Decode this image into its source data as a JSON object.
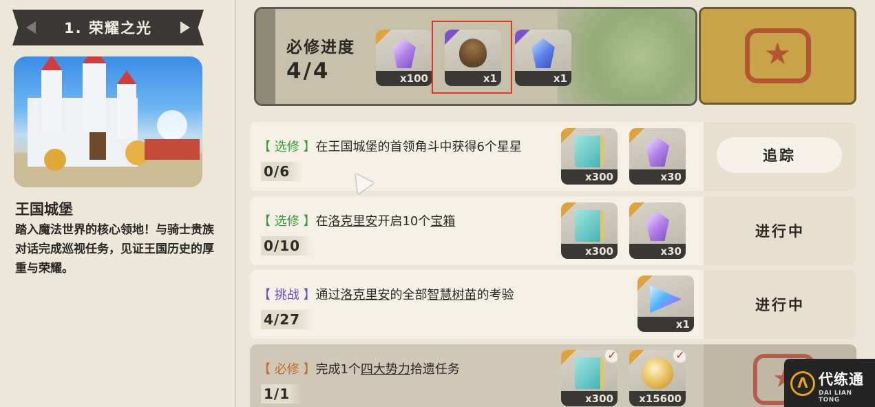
{
  "left": {
    "title": "1. 荣耀之光",
    "location_name": "王国城堡",
    "description": "踏入魔法世界的核心领地！与骑士贵族对话完成巡视任务，见证王国历史的厚重与荣耀。"
  },
  "progress": {
    "label": "必修进度",
    "value": "4/4",
    "rewards": [
      {
        "icon": "purple-crystal-icon",
        "count": "x100"
      },
      {
        "icon": "acorn-icon",
        "count": "x1"
      },
      {
        "icon": "blue-crystal-icon",
        "count": "x1"
      }
    ]
  },
  "quests": [
    {
      "tag": "【 选修 】",
      "text_parts": [
        "在王国城堡的首领角斗中获得6个星星"
      ],
      "count": "0/6",
      "rewards": [
        {
          "icon": "book-icon",
          "count": "x300"
        },
        {
          "icon": "purple-crystal-icon",
          "count": "x30"
        }
      ],
      "action": "追踪"
    },
    {
      "tag": "【 选修 】",
      "text_parts": [
        "在",
        "洛克里安",
        "开启10个",
        "宝箱"
      ],
      "count": "0/10",
      "rewards": [
        {
          "icon": "book-icon",
          "count": "x300"
        },
        {
          "icon": "purple-crystal-icon",
          "count": "x30"
        }
      ],
      "action": "进行中"
    },
    {
      "tag": "【 挑战 】",
      "text_parts": [
        "通过",
        "洛克里安",
        "的全部",
        "智慧树苗",
        "的考验"
      ],
      "count": "4/27",
      "rewards": [
        {
          "icon": "prism-icon",
          "count": "x1"
        }
      ],
      "action": "进行中"
    },
    {
      "tag": "【 必修 】",
      "text_parts": [
        "完成1个",
        "四大势力",
        "拾遗任务"
      ],
      "count": "1/1",
      "rewards": [
        {
          "icon": "book-icon",
          "count": "x300"
        },
        {
          "icon": "coin-icon",
          "count": "x15600"
        }
      ],
      "check_mark": "✓"
    }
  ],
  "watermark": {
    "brand": "代练通",
    "sub": "DAI LIAN TONG"
  },
  "colors": {
    "background": "#ece6d8",
    "highlight_box": "#e0352b",
    "tag_elective": "#3d9a3a",
    "tag_challenge": "#6a4bc0",
    "tag_required": "#c46a1f"
  }
}
